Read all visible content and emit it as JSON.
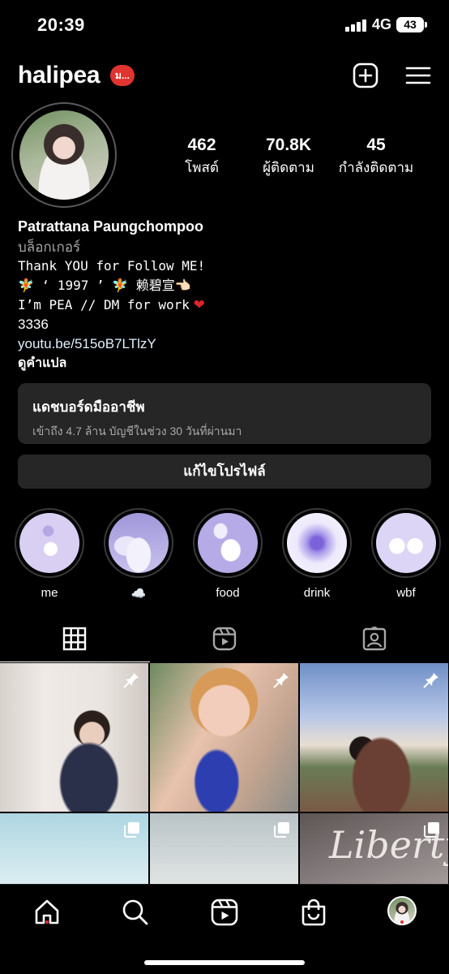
{
  "status_bar": {
    "time": "20:39",
    "network": "4G",
    "battery": "43"
  },
  "header": {
    "username": "halipea",
    "notification_badge": "ม...",
    "icons": [
      "plus-square-icon",
      "menu-icon"
    ]
  },
  "profile": {
    "stats": [
      {
        "value": "462",
        "label": "โพสต์"
      },
      {
        "value": "70.8K",
        "label": "ผู้ติดตาม"
      },
      {
        "value": "45",
        "label": "กำลังติดตาม"
      }
    ],
    "name": "Patrattana Paungchompoo",
    "category": "บล็อกเกอร์",
    "bio_lines": [
      "Thank YOU for Follow ME!",
      "🧚 ‘ 1997 ’ 🧚 赖碧宣👈🏻",
      "I’m PEA // DM for work",
      "3336"
    ],
    "link": "youtu.be/515oB7LTlzY",
    "translate": "ดูคำแปล"
  },
  "dashboard": {
    "title": "แดชบอร์ดมืออาชีพ",
    "subtitle": "เข้าถึง 4.7 ล้าน บัญชีในช่วง 30 วันที่ผ่านมา"
  },
  "edit_profile": "แก้ไขโปรไฟล์",
  "highlights": [
    {
      "label": "me"
    },
    {
      "label": "☁️"
    },
    {
      "label": "food"
    },
    {
      "label": "drink"
    },
    {
      "label": "wbf"
    }
  ],
  "tabs": [
    "grid-icon",
    "reels-icon",
    "tagged-icon"
  ],
  "grid": [
    {
      "badge": "pin-icon"
    },
    {
      "badge": "pin-icon"
    },
    {
      "badge": "pin-icon"
    },
    {
      "badge": "multi-photo-icon"
    },
    {
      "badge": "multi-photo-icon"
    },
    {
      "badge": "multi-photo-icon",
      "text": "Liberty"
    }
  ],
  "bottom_nav": [
    "home-icon",
    "search-icon",
    "reels-icon",
    "shop-icon",
    "profile-avatar"
  ],
  "colors": {
    "background": "#000000",
    "surface": "#262626",
    "badge": "#e0342f",
    "secondary_text": "#a8a8a8"
  }
}
